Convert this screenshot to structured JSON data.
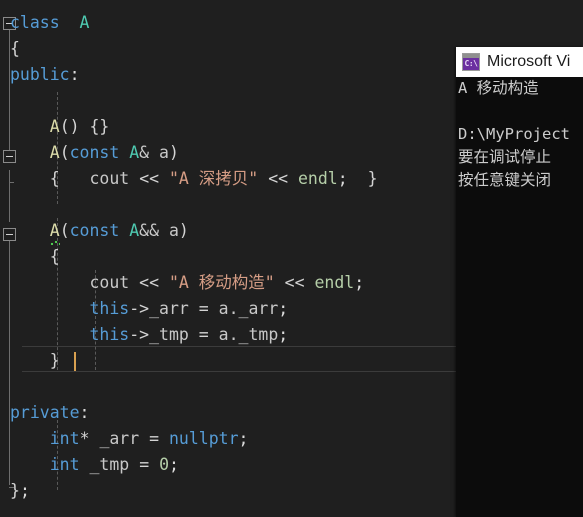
{
  "editor": {
    "name": "code-editor",
    "background": "#1f1f1f",
    "lines": [
      {
        "indent": 0,
        "tokens": [
          {
            "t": "class",
            "c": "kw"
          },
          {
            "t": "  ",
            "c": "plain"
          },
          {
            "t": "A",
            "c": "type"
          }
        ]
      },
      {
        "indent": 0,
        "tokens": [
          {
            "t": "{",
            "c": "brace"
          }
        ]
      },
      {
        "indent": 0,
        "tokens": [
          {
            "t": "public",
            "c": "kw"
          },
          {
            "t": ":",
            "c": "punct"
          }
        ]
      },
      {
        "indent": 0,
        "tokens": []
      },
      {
        "indent": 0,
        "tokens": [
          {
            "t": "    ",
            "c": "plain"
          },
          {
            "t": "A",
            "c": "fn"
          },
          {
            "t": "() {}",
            "c": "brace"
          }
        ]
      },
      {
        "indent": 0,
        "tokens": [
          {
            "t": "    ",
            "c": "plain"
          },
          {
            "t": "A",
            "c": "fn"
          },
          {
            "t": "(",
            "c": "brace"
          },
          {
            "t": "const",
            "c": "kw"
          },
          {
            "t": " ",
            "c": "plain"
          },
          {
            "t": "A",
            "c": "type"
          },
          {
            "t": "& a",
            "c": "member"
          },
          {
            "t": ")",
            "c": "brace"
          }
        ]
      },
      {
        "indent": 0,
        "tokens": [
          {
            "t": "    ",
            "c": "plain"
          },
          {
            "t": "{",
            "c": "brace"
          },
          {
            "t": "   ",
            "c": "plain"
          },
          {
            "t": "cout",
            "c": "member"
          },
          {
            "t": " ",
            "c": "plain"
          },
          {
            "t": "<<",
            "c": "brace"
          },
          {
            "t": " ",
            "c": "plain"
          },
          {
            "t": "\"A 深拷贝\"",
            "c": "str"
          },
          {
            "t": " ",
            "c": "plain"
          },
          {
            "t": "<<",
            "c": "brace"
          },
          {
            "t": " ",
            "c": "plain"
          },
          {
            "t": "endl",
            "c": "num"
          },
          {
            "t": ";",
            "c": "punct"
          },
          {
            "t": "  ",
            "c": "plain"
          },
          {
            "t": "}",
            "c": "brace"
          }
        ]
      },
      {
        "indent": 0,
        "tokens": []
      },
      {
        "indent": 0,
        "tokens": [
          {
            "t": "    ",
            "c": "plain"
          },
          {
            "t": "A",
            "c": "fn squiggle"
          },
          {
            "t": "(",
            "c": "brace"
          },
          {
            "t": "const",
            "c": "kw"
          },
          {
            "t": " ",
            "c": "plain"
          },
          {
            "t": "A",
            "c": "type"
          },
          {
            "t": "&& a",
            "c": "member"
          },
          {
            "t": ")",
            "c": "brace"
          }
        ]
      },
      {
        "indent": 0,
        "tokens": [
          {
            "t": "    ",
            "c": "plain"
          },
          {
            "t": "{",
            "c": "brace"
          }
        ]
      },
      {
        "indent": 0,
        "tokens": [
          {
            "t": "        ",
            "c": "plain"
          },
          {
            "t": "cout",
            "c": "member"
          },
          {
            "t": " ",
            "c": "plain"
          },
          {
            "t": "<<",
            "c": "brace"
          },
          {
            "t": " ",
            "c": "plain"
          },
          {
            "t": "\"A 移动构造\"",
            "c": "str"
          },
          {
            "t": " ",
            "c": "plain"
          },
          {
            "t": "<<",
            "c": "brace"
          },
          {
            "t": " ",
            "c": "plain"
          },
          {
            "t": "endl",
            "c": "num"
          },
          {
            "t": ";",
            "c": "punct"
          }
        ]
      },
      {
        "indent": 0,
        "tokens": [
          {
            "t": "        ",
            "c": "plain"
          },
          {
            "t": "this",
            "c": "kw"
          },
          {
            "t": "->",
            "c": "brace"
          },
          {
            "t": "_arr",
            "c": "member"
          },
          {
            "t": " ",
            "c": "plain"
          },
          {
            "t": "=",
            "c": "brace"
          },
          {
            "t": " a.",
            "c": "member"
          },
          {
            "t": "_arr",
            "c": "member"
          },
          {
            "t": ";",
            "c": "punct"
          }
        ]
      },
      {
        "indent": 0,
        "tokens": [
          {
            "t": "        ",
            "c": "plain"
          },
          {
            "t": "this",
            "c": "kw"
          },
          {
            "t": "->",
            "c": "brace"
          },
          {
            "t": "_tmp",
            "c": "member"
          },
          {
            "t": " ",
            "c": "plain"
          },
          {
            "t": "=",
            "c": "brace"
          },
          {
            "t": " a.",
            "c": "member"
          },
          {
            "t": "_tmp",
            "c": "member"
          },
          {
            "t": ";",
            "c": "punct"
          }
        ]
      },
      {
        "indent": 0,
        "tokens": [
          {
            "t": "    ",
            "c": "plain"
          },
          {
            "t": "}",
            "c": "brace"
          }
        ]
      },
      {
        "indent": 0,
        "tokens": []
      },
      {
        "indent": 0,
        "tokens": [
          {
            "t": "private",
            "c": "kw"
          },
          {
            "t": ":",
            "c": "punct"
          }
        ]
      },
      {
        "indent": 0,
        "tokens": [
          {
            "t": "    ",
            "c": "plain"
          },
          {
            "t": "int",
            "c": "kw"
          },
          {
            "t": "*",
            "c": "brace"
          },
          {
            "t": " ",
            "c": "plain"
          },
          {
            "t": "_arr",
            "c": "member"
          },
          {
            "t": " ",
            "c": "plain"
          },
          {
            "t": "=",
            "c": "brace"
          },
          {
            "t": " ",
            "c": "plain"
          },
          {
            "t": "nullptr",
            "c": "kw"
          },
          {
            "t": ";",
            "c": "punct"
          }
        ]
      },
      {
        "indent": 0,
        "tokens": [
          {
            "t": "    ",
            "c": "plain"
          },
          {
            "t": "int",
            "c": "kw"
          },
          {
            "t": " ",
            "c": "plain"
          },
          {
            "t": "_tmp",
            "c": "member"
          },
          {
            "t": " ",
            "c": "plain"
          },
          {
            "t": "=",
            "c": "brace"
          },
          {
            "t": " ",
            "c": "plain"
          },
          {
            "t": "0",
            "c": "num"
          },
          {
            "t": ";",
            "c": "punct"
          }
        ]
      },
      {
        "indent": 0,
        "tokens": [
          {
            "t": "}",
            "c": "brace"
          },
          {
            "t": ";",
            "c": "punct"
          }
        ]
      }
    ],
    "current_line_index": 13,
    "source_text": "class  A\n{\npublic:\n\n    A() {}\n    A(const A& a)\n    {   cout << \"A 深拷贝\" << endl;  }\n\n    A(const A&& a)\n    {\n        cout << \"A 移动构造\" << endl;\n        this->_arr = a._arr;\n        this->_tmp = a._tmp;\n    }\n\nprivate:\n    int* _arr = nullptr;\n    int _tmp = 0;\n};"
  },
  "console": {
    "name": "debug-console-window",
    "title": "Microsoft Vi",
    "icon": "console-icon",
    "icon_glyph": "C:\\",
    "icon_color": "#6b2fa0",
    "background": "#0c0c0c",
    "text_color": "#cccccc",
    "lines": [
      "A 移动构造",
      "",
      "D:\\MyProject",
      "要在调试停止",
      "按任意键关闭"
    ]
  },
  "colors": {
    "editor_background": "#1f1f1f",
    "keyword": "#569cd6",
    "type": "#4ec9b0",
    "function": "#dcdcaa",
    "string": "#d69d85",
    "number": "#b5cea8",
    "plain": "#dcdcdc",
    "member": "#c8c8c8",
    "squiggle_error": "#4ec94e",
    "caret": "#d8a050",
    "current_line_border": "#3b3b3b"
  }
}
